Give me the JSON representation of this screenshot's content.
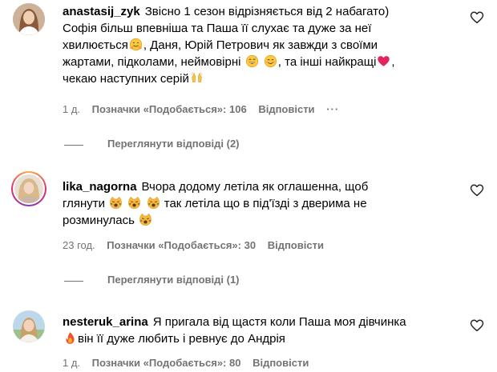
{
  "comments": [
    {
      "username": "anastasij_zyk",
      "lines": [
        "Звісно 1 сезон відрізняється від 2 набагато)",
        "Софія більш впевніша та Паша її слухає та дуже за неї",
        "хвилюється",
        ", Даня, Юрій Петрович як завжди з своїми",
        "жартами, підколами, неймовірні",
        ", та інші найкращі",
        "чекаю наступних серій"
      ],
      "time": "1 д.",
      "likes": "Позначки «Подобається»: 106",
      "reply": "Відповісти",
      "more": "···",
      "view_replies": "Переглянути відповіді (2)"
    },
    {
      "username": "lika_nagorna",
      "lines": [
        "Вчора додому летіла як оглашенна, щоб",
        "глянути",
        "так летіла що в під'їзді з дверима не",
        "розминулась"
      ],
      "time": "23 год.",
      "likes": "Позначки «Подобається»: 30",
      "reply": "Відповісти",
      "view_replies": "Переглянути відповіді (1)"
    },
    {
      "username": "nesteruk_arina",
      "lines": [
        "Я пригала від щастя коли Паша моя дівчинка",
        "він її дуже любить і ревнує до Андрія"
      ],
      "time": "1 д.",
      "likes": "Позначки «Подобається»: 80",
      "reply": "Відповісти"
    }
  ],
  "icons": {
    "like": "heart-outline-icon",
    "more": "more-options-icon",
    "emoji_hug": "smiling-face-with-open-hands",
    "emoji_grin_sweat": "grinning-face-with-sweat",
    "emoji_blush": "smiling-face-with-smiling-eyes",
    "emoji_heart": "red-heart",
    "emoji_pray": "raising-hands",
    "emoji_cat": "weary-cat-face",
    "emoji_fire": "fire"
  },
  "colors": {
    "text": "#000000",
    "secondary": "#737373",
    "heart": "#e0245e"
  }
}
